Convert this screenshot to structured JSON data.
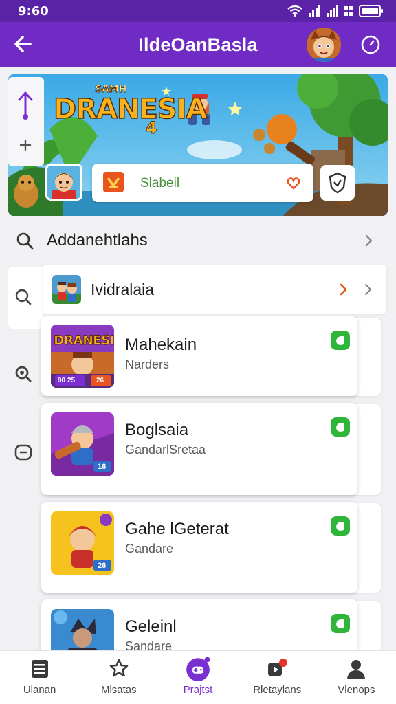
{
  "status_bar": {
    "time": "9:60"
  },
  "app_bar": {
    "title": "IldeOanBasla"
  },
  "banner": {
    "logo_small": "SAMH",
    "logo_main": "DRANESIA",
    "logo_number": "4",
    "field_text": "Slabeil"
  },
  "search_row": {
    "label": "Addanehtlahs"
  },
  "featured_row": {
    "label": "Ividralaia"
  },
  "games": [
    {
      "title": "Mahekain",
      "subtitle": "Narders",
      "thumb_text": "DRANESIA",
      "badge_left": "90 25",
      "badge_right": "26"
    },
    {
      "title": "Boglsaia",
      "subtitle": "GandarlSretaa",
      "badge_right": "16"
    },
    {
      "title": "Gahe lGeterat",
      "subtitle": "Gandare",
      "badge_right": "26"
    },
    {
      "title": "Geleinl",
      "subtitle": "Sandare"
    }
  ],
  "bottom_nav": {
    "items": [
      {
        "label": "Ulanan",
        "icon": "list-icon"
      },
      {
        "label": "Mlsatas",
        "icon": "star-badge-icon"
      },
      {
        "label": "Prajtst",
        "icon": "gamepad-icon",
        "active": true
      },
      {
        "label": "Rletaylans",
        "icon": "video-icon"
      },
      {
        "label": "Vlenops",
        "icon": "person-icon"
      }
    ]
  },
  "colors": {
    "status_bar": "#5a22a6",
    "app_bar": "#6f2bc4",
    "accent": "#7a2fd0",
    "check_green": "#2fb53a",
    "chevron_orange": "#e8531e"
  }
}
